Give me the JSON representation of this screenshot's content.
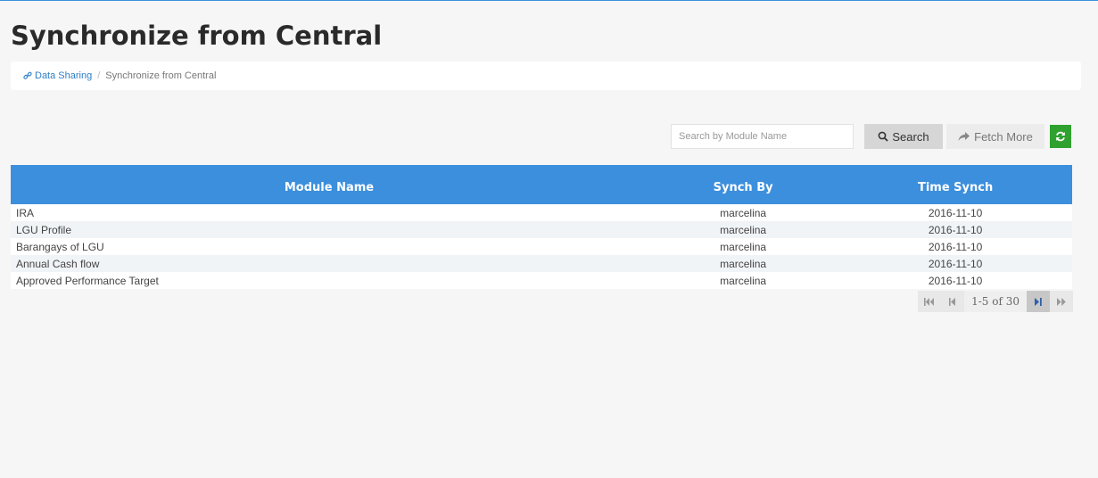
{
  "page": {
    "title": "Synchronize from Central"
  },
  "breadcrumb": {
    "parent": "Data Sharing",
    "separator": "/",
    "current": "Synchronize from Central"
  },
  "toolbar": {
    "search_placeholder": "Search by Module Name",
    "search_value": "",
    "search_label": "Search",
    "fetch_label": "Fetch More"
  },
  "table": {
    "headers": {
      "module": "Module Name",
      "by": "Synch By",
      "time": "Time Synch"
    },
    "rows": [
      {
        "module": "IRA",
        "by": "marcelina",
        "time": "2016-11-10"
      },
      {
        "module": "LGU Profile",
        "by": "marcelina",
        "time": "2016-11-10"
      },
      {
        "module": "Barangays of LGU",
        "by": "marcelina",
        "time": "2016-11-10"
      },
      {
        "module": "Annual Cash flow",
        "by": "marcelina",
        "time": "2016-11-10"
      },
      {
        "module": "Approved Performance Target",
        "by": "marcelina",
        "time": "2016-11-10"
      }
    ]
  },
  "pager": {
    "info": "1-5 of 30"
  },
  "colors": {
    "accent": "#3c8fdc",
    "refresh": "#2fa12f",
    "link": "#2f7ec8"
  },
  "icons": [
    "link-icon",
    "search-icon",
    "share-arrow-icon",
    "refresh-icon",
    "first-page-icon",
    "prev-page-icon",
    "next-page-icon",
    "last-page-icon"
  ]
}
